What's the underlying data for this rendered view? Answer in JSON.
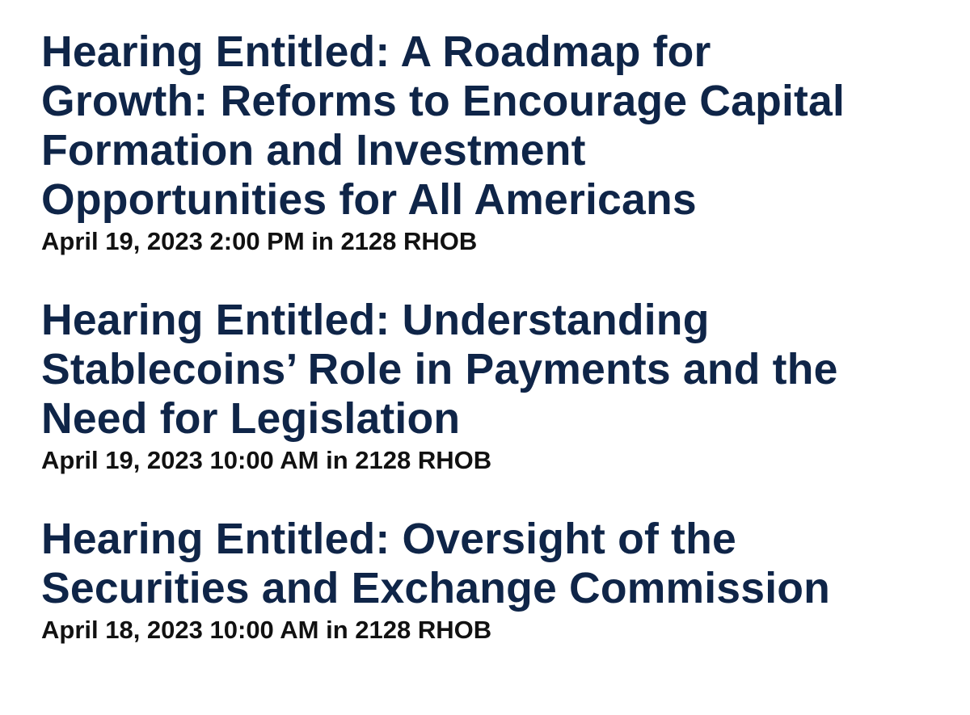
{
  "hearings": [
    {
      "title": "Hearing Entitled: A Roadmap for Growth: Reforms to Encourage Capital Formation and Investment Opportunities for All Americans",
      "title_lines": [
        "Hearing Entitled: A Roadmap for",
        "Growth: Reforms to Encourage Capital",
        "Formation and Investment",
        "Opportunities for All Americans"
      ],
      "meta": "April 19, 2023 2:00 PM in 2128 RHOB"
    },
    {
      "title": "Hearing Entitled: Understanding Stablecoins’ Role in Payments and the Need for Legislation",
      "title_lines": [
        "Hearing Entitled: Understanding",
        "Stablecoins’ Role in Payments and the",
        "Need for Legislation"
      ],
      "meta": "April 19, 2023 10:00 AM in 2128 RHOB"
    },
    {
      "title": "Hearing Entitled: Oversight of the Securities and Exchange Commission",
      "title_lines": [
        "Hearing Entitled: Oversight of the",
        "Securities and Exchange Commission"
      ],
      "meta": "April 18, 2023 10:00 AM in 2128 RHOB"
    }
  ],
  "colors": {
    "title": "#0f2548",
    "meta": "#111111",
    "background": "#ffffff"
  }
}
